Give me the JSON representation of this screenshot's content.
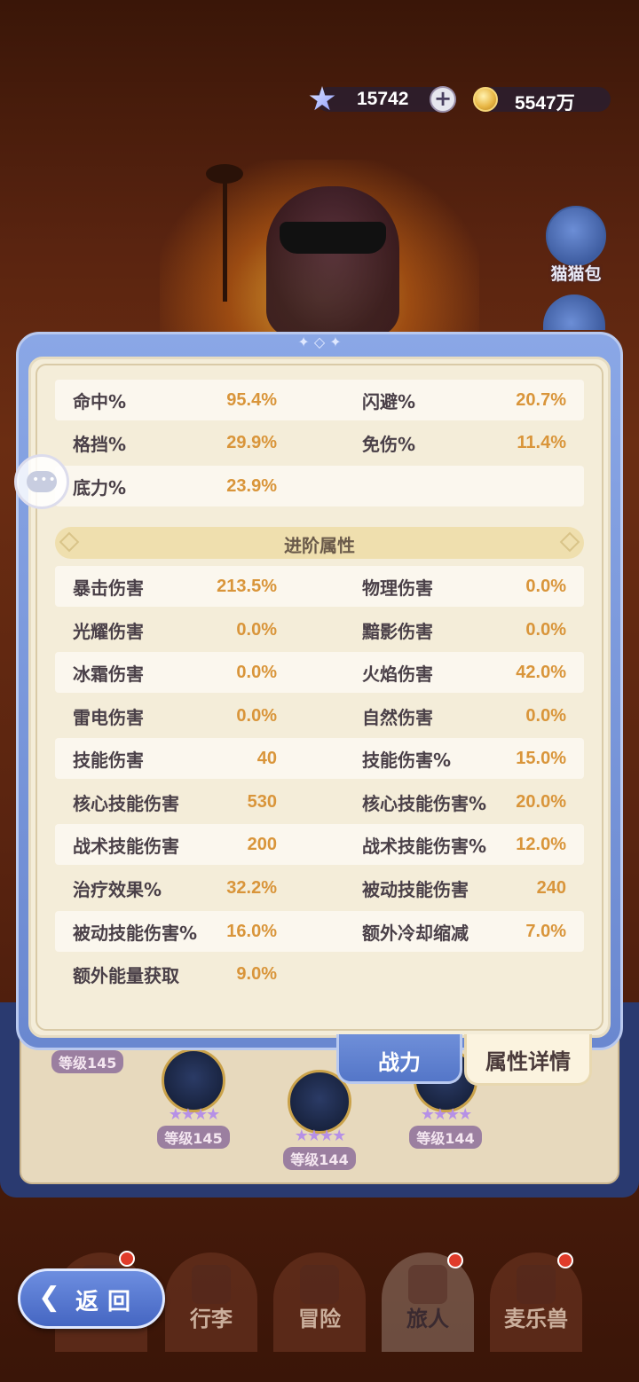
{
  "currency": {
    "gems": "15742",
    "plus": "+",
    "gold": "5547万"
  },
  "side": {
    "bag_label": "猫猫包"
  },
  "stats_basic": [
    {
      "l1": "命中%",
      "v1": "95.4%",
      "l2": "闪避%",
      "v2": "20.7%"
    },
    {
      "l1": "格挡%",
      "v1": "29.9%",
      "l2": "免伤%",
      "v2": "11.4%"
    },
    {
      "l1": "底力%",
      "v1": "23.9%",
      "l2": "",
      "v2": ""
    }
  ],
  "section": {
    "title": "进阶属性"
  },
  "stats_advanced": [
    {
      "l1": "暴击伤害",
      "v1": "213.5%",
      "l2": "物理伤害",
      "v2": "0.0%"
    },
    {
      "l1": "光耀伤害",
      "v1": "0.0%",
      "l2": "黯影伤害",
      "v2": "0.0%"
    },
    {
      "l1": "冰霜伤害",
      "v1": "0.0%",
      "l2": "火焰伤害",
      "v2": "42.0%"
    },
    {
      "l1": "雷电伤害",
      "v1": "0.0%",
      "l2": "自然伤害",
      "v2": "0.0%"
    },
    {
      "l1": "技能伤害",
      "v1": "40",
      "l2": "技能伤害%",
      "v2": "15.0%"
    },
    {
      "l1": "核心技能伤害",
      "v1": "530",
      "l2": "核心技能伤害%",
      "v2": "20.0%"
    },
    {
      "l1": "战术技能伤害",
      "v1": "200",
      "l2": "战术技能伤害%",
      "v2": "12.0%"
    },
    {
      "l1": "治疗效果%",
      "v1": "32.2%",
      "l2": "被动技能伤害",
      "v2": "240"
    },
    {
      "l1": "被动技能伤害%",
      "v1": "16.0%",
      "l2": "额外冷却缩减",
      "v2": "7.0%"
    },
    {
      "l1": "额外能量获取",
      "v1": "9.0%",
      "l2": "",
      "v2": ""
    }
  ],
  "tabs": {
    "power": "战力",
    "detail": "属性详情"
  },
  "units": [
    {
      "level": "等级145"
    },
    {
      "level": "等级145"
    },
    {
      "level": "等级144"
    },
    {
      "level": "等级144"
    }
  ],
  "stars": "★★★★",
  "nav": {
    "back": "返回",
    "items": [
      "行李",
      "冒险",
      "旅人",
      "麦乐兽"
    ]
  },
  "colors": {
    "accent_blue": "#6a88d0",
    "value_orange": "#d9953a",
    "panel_cream": "#f4edd9"
  }
}
